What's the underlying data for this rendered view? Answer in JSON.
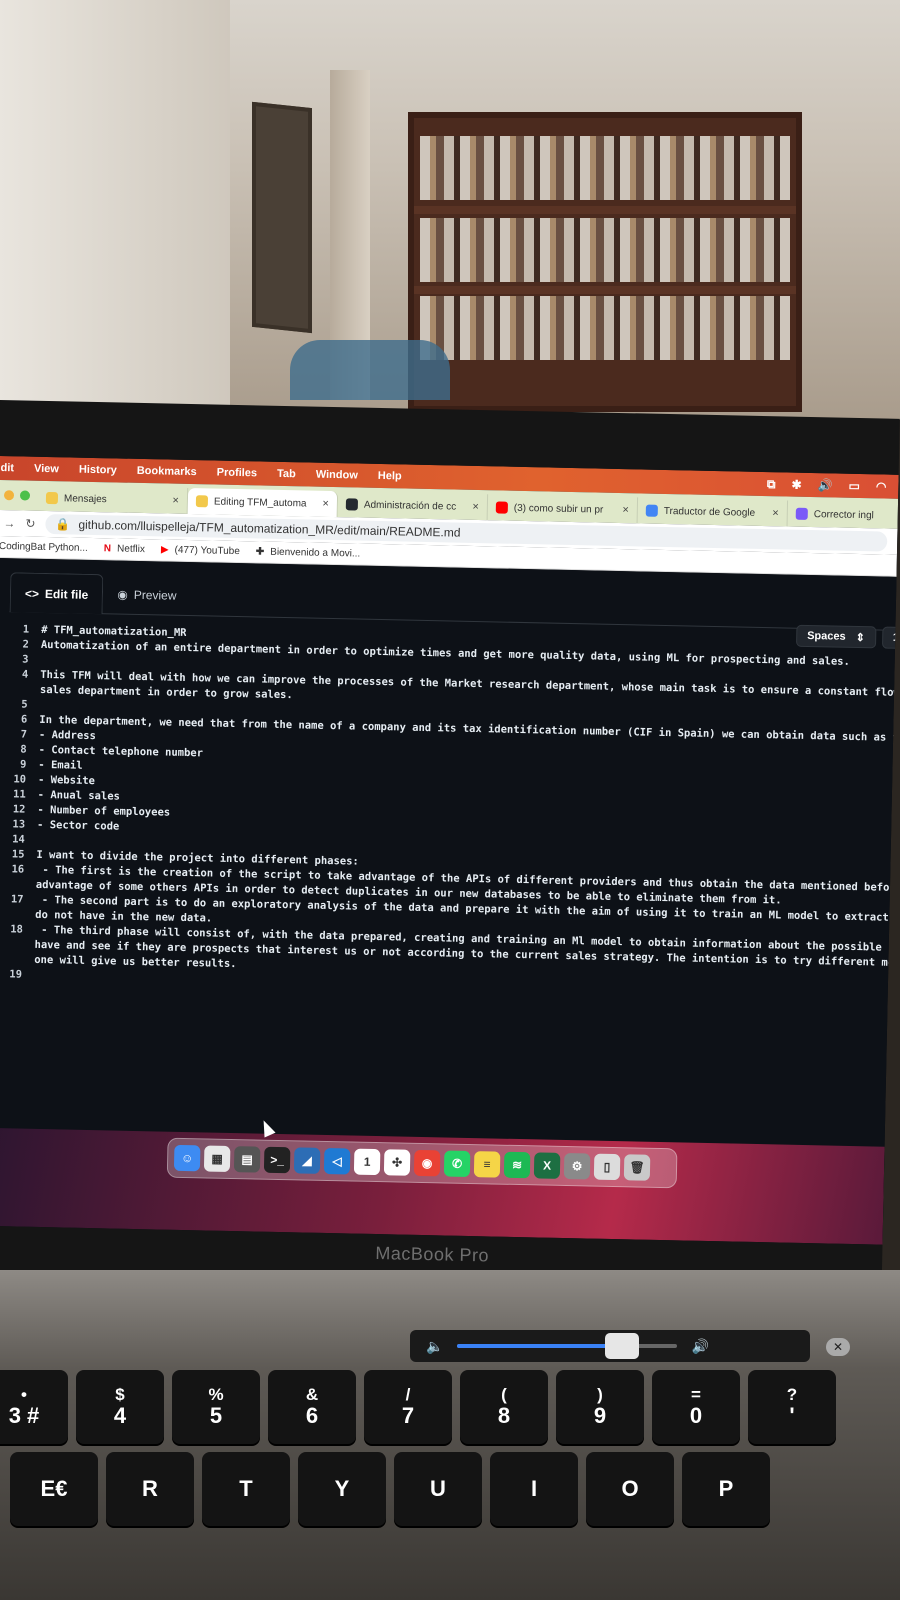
{
  "menubar": {
    "items": [
      "dit",
      "View",
      "History",
      "Bookmarks",
      "Profiles",
      "Tab",
      "Window",
      "Help"
    ]
  },
  "tabs": [
    {
      "title": "Mensajes",
      "color": "#f2c84b",
      "active": false
    },
    {
      "title": "Editing TFM_automa",
      "color": "#f2c84b",
      "active": true
    },
    {
      "title": "Administración de cc",
      "color": "#24292f",
      "active": false
    },
    {
      "title": "(3) como subir un pr",
      "color": "#ff0000",
      "active": false
    },
    {
      "title": "Traductor de Google",
      "color": "#4285f4",
      "active": false
    },
    {
      "title": "Corrector ingl",
      "color": "#7a5af8",
      "active": false
    }
  ],
  "toolbar": {
    "url": "github.com/lluispelleja/TFM_automatization_MR/edit/main/README.md"
  },
  "bookmarks": [
    "CodingBat Python...",
    "Netflix",
    "(477) YouTube",
    "Bienvenido a Movi..."
  ],
  "editor": {
    "tab_edit": "Edit file",
    "tab_preview": "Preview",
    "indent_mode": "Spaces",
    "indent_size": "1",
    "lines": [
      {
        "n": "1",
        "text": "# TFM_automatization_MR"
      },
      {
        "n": "2",
        "text": "Automatization of an entire department in order to optimize times and get more quality data, using ML for prospecting and sales."
      },
      {
        "n": "3",
        "text": ""
      },
      {
        "n": "4",
        "text": "This TFM will deal with how we can improve the processes of the Market research department, whose main task is to ensure a constant flow o"
      },
      {
        "n": "",
        "text": "sales department in order to grow sales."
      },
      {
        "n": "5",
        "text": ""
      },
      {
        "n": "6",
        "text": "In the department, we need that from the name of a company and its tax identification number (CIF in Spain) we can obtain data such as the"
      },
      {
        "n": "7",
        "text": "- Address"
      },
      {
        "n": "8",
        "text": "- Contact telephone number"
      },
      {
        "n": "9",
        "text": "- Email"
      },
      {
        "n": "10",
        "text": "- Website"
      },
      {
        "n": "11",
        "text": "- Anual sales"
      },
      {
        "n": "12",
        "text": "- Number of employees"
      },
      {
        "n": "13",
        "text": "- Sector code"
      },
      {
        "n": "14",
        "text": ""
      },
      {
        "n": "15",
        "text": "I want to divide the project into different phases:"
      },
      {
        "n": "16",
        "text": " - The first is the creation of the script to take advantage of the APIs of different providers and thus obtain the data mentioned before,"
      },
      {
        "n": "",
        "text": "advantage of some others APIs in order to detect duplicates in our new databases to be able to eliminate them from it."
      },
      {
        "n": "17",
        "text": " - The second part is to do an exploratory analysis of the data and prepare it with the aim of using it to train an ML model to extract in"
      },
      {
        "n": "",
        "text": "do not have in the new data."
      },
      {
        "n": "18",
        "text": " - The third phase will consist of, with the data prepared, creating and training an Ml model to obtain information about the possible fle"
      },
      {
        "n": "",
        "text": "have and see if they are prospects that interest us or not according to the current sales strategy. The intention is to try different mode"
      },
      {
        "n": "",
        "text": "one will give us better results."
      },
      {
        "n": "19",
        "text": ""
      }
    ]
  },
  "dock": {
    "apps": [
      {
        "name": "finder-icon",
        "color": "#3d8bf2",
        "glyph": "☺"
      },
      {
        "name": "launchpad-icon",
        "color": "#e8e8e8",
        "glyph": "▦"
      },
      {
        "name": "calculator-icon",
        "color": "#555555",
        "glyph": "▤"
      },
      {
        "name": "terminal-icon",
        "color": "#222222",
        "glyph": ">_"
      },
      {
        "name": "mysql-workbench-icon",
        "color": "#2d6db5",
        "glyph": "◢"
      },
      {
        "name": "vscode-icon",
        "color": "#1f7ad3",
        "glyph": "◁"
      },
      {
        "name": "calendar-icon",
        "color": "#ffffff",
        "glyph": "1"
      },
      {
        "name": "slack-icon",
        "color": "#ffffff",
        "glyph": "✣"
      },
      {
        "name": "chrome-icon",
        "color": "#e94235",
        "glyph": "◉"
      },
      {
        "name": "whatsapp-icon",
        "color": "#25d366",
        "glyph": "✆"
      },
      {
        "name": "notes-icon",
        "color": "#f5d547",
        "glyph": "≡"
      },
      {
        "name": "spotify-icon",
        "color": "#1db954",
        "glyph": "≋"
      },
      {
        "name": "excel-icon",
        "color": "#1d6f42",
        "glyph": "X"
      },
      {
        "name": "system-preferences-icon",
        "color": "#8a8a8a",
        "glyph": "⚙"
      },
      {
        "name": "documents-icon",
        "color": "#dcdcdc",
        "glyph": "▯"
      },
      {
        "name": "trash-icon",
        "color": "#c9c9c9",
        "glyph": "🗑"
      }
    ]
  },
  "laptop_brand": "MacBook Pro",
  "keyboard": {
    "row1": [
      {
        "top": "•",
        "main": "3 #"
      },
      {
        "top": "$",
        "main": "4"
      },
      {
        "top": "%",
        "main": "5"
      },
      {
        "top": "&",
        "main": "6"
      },
      {
        "top": "/",
        "main": "7"
      },
      {
        "top": "(",
        "main": "8"
      },
      {
        "top": ")",
        "main": "9"
      },
      {
        "top": "=",
        "main": "0"
      },
      {
        "top": "?",
        "main": "'"
      }
    ],
    "row2": [
      "E€",
      "R",
      "T",
      "Y",
      "U",
      "I",
      "O",
      "P"
    ]
  },
  "volume_level": 0.75
}
